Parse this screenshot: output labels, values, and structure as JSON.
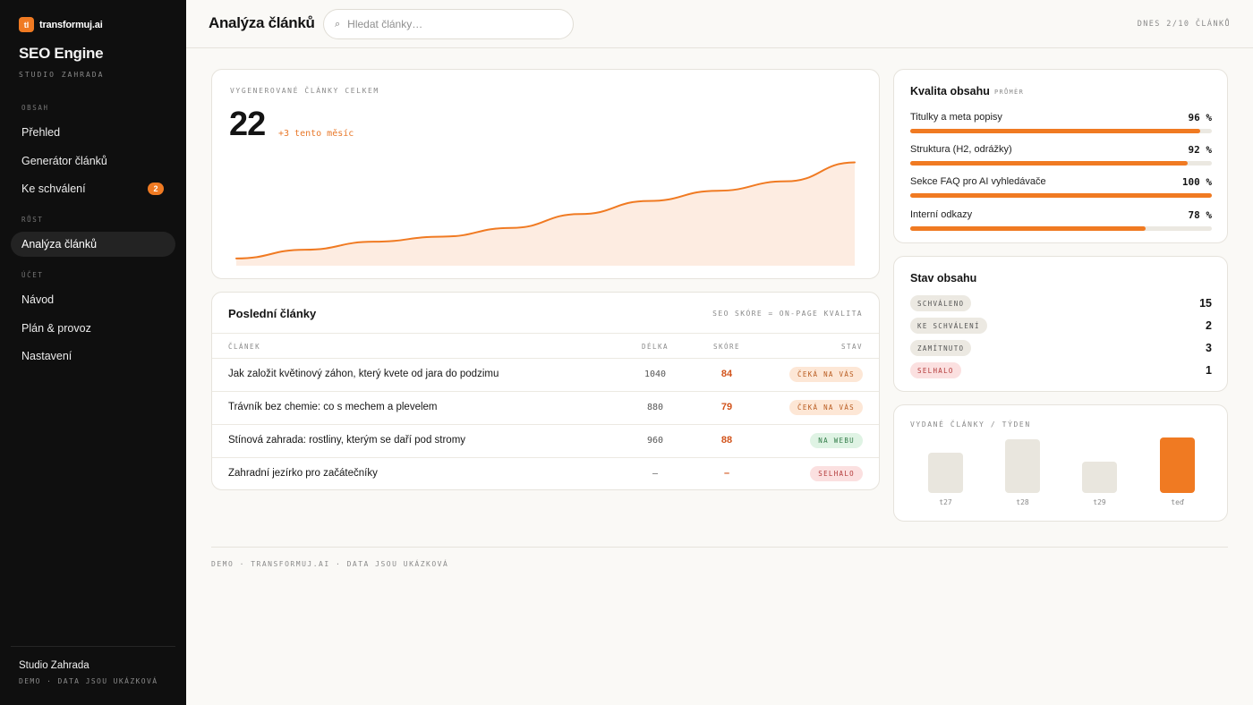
{
  "brand": {
    "logo_mark": "tl",
    "logo_text": "transformuj.ai",
    "app_name": "SEO Engine",
    "workspace": "STUDIO ZAHRADA",
    "accent": "#f07a22"
  },
  "sidebar": {
    "sections": [
      {
        "label": "OBSAH",
        "items": [
          {
            "label": "Přehled"
          },
          {
            "label": "Generátor článků"
          },
          {
            "label": "Ke schválení",
            "badge": "2"
          }
        ]
      },
      {
        "label": "RŮST",
        "items": [
          {
            "label": "Analýza článků",
            "active": true
          }
        ]
      },
      {
        "label": "ÚČET",
        "items": [
          {
            "label": "Návod"
          },
          {
            "label": "Plán & provoz"
          },
          {
            "label": "Nastavení"
          }
        ]
      }
    ],
    "footer_name": "Studio Zahrada",
    "footer_note": "DEMO · DATA JSOU UKÁZKOVÁ"
  },
  "topbar": {
    "title": "Analýza článků",
    "search_placeholder": "Hledat články…",
    "meta": "DNES 2/10 ČLÁNKŮ"
  },
  "total": {
    "kicker": "VYGENEROVANÉ ČLÁNKY CELKEM",
    "value": "22",
    "delta": "+3 tento měsíc",
    "trend": [
      8,
      9.2,
      10.3,
      11,
      12.2,
      14.1,
      15.9,
      17.3,
      18.6,
      21.2
    ]
  },
  "articles": {
    "title": "Poslední články",
    "meta": "SEO SKÓRE = ON-PAGE KVALITA",
    "columns": {
      "article": "ČLÁNEK",
      "length": "DÉLKA",
      "score": "SKÓRE",
      "status": "STAV"
    },
    "rows": [
      {
        "title": "Jak založit květinový záhon, který kvete od jara do podzimu",
        "length": "1040",
        "score": "84",
        "status": "ČEKÁ NA VÁS",
        "status_kind": "pending"
      },
      {
        "title": "Trávník bez chemie: co s mechem a plevelem",
        "length": "880",
        "score": "79",
        "status": "ČEKÁ NA VÁS",
        "status_kind": "pending"
      },
      {
        "title": "Stínová zahrada: rostliny, kterým se daří pod stromy",
        "length": "960",
        "score": "88",
        "status": "NA WEBU",
        "status_kind": "live"
      },
      {
        "title": "Zahradní jezírko pro začátečníky",
        "length": "–",
        "score": "–",
        "status": "SELHALO",
        "status_kind": "failed"
      }
    ]
  },
  "quality": {
    "title": "Kvalita obsahu",
    "subtitle": "PRŮMĚR",
    "metrics": [
      {
        "label": "Titulky a meta popisy",
        "value": "96 %",
        "percent": 96
      },
      {
        "label": "Struktura (H2, odrážky)",
        "value": "92 %",
        "percent": 92
      },
      {
        "label": "Sekce FAQ pro AI vyhledávače",
        "value": "100 %",
        "percent": 100
      },
      {
        "label": "Interní odkazy",
        "value": "78 %",
        "percent": 78
      }
    ]
  },
  "status": {
    "title": "Stav obsahu",
    "rows": [
      {
        "label": "SCHVÁLENO",
        "count": "15",
        "kind": "neutral"
      },
      {
        "label": "KE SCHVÁLENÍ",
        "count": "2",
        "kind": "neutral"
      },
      {
        "label": "ZAMÍTNUTO",
        "count": "3",
        "kind": "neutral"
      },
      {
        "label": "SELHALO",
        "count": "1",
        "kind": "failed"
      }
    ]
  },
  "weekly": {
    "kicker": "VYDANÉ ČLÁNKY / TÝDEN",
    "bars": [
      {
        "label": "t27",
        "value": 0.72,
        "current": false
      },
      {
        "label": "t28",
        "value": 0.96,
        "current": false
      },
      {
        "label": "t29",
        "value": 0.57,
        "current": false
      },
      {
        "label": "teď",
        "value": 1.0,
        "current": true
      }
    ]
  },
  "footer": "DEMO · TRANSFORMUJ.AI · DATA JSOU UKÁZKOVÁ",
  "colors": {
    "accent": "#f07a22",
    "score": "#d2541c",
    "pending_bg": "#fde7d6",
    "pending_fg": "#b85a1e",
    "live_bg": "#dff3e4",
    "live_fg": "#2f7a46",
    "failed_bg": "#fbe0e0",
    "failed_fg": "#b33a3a",
    "neutral_bg": "#ece9e2",
    "neutral_fg": "#555555",
    "bar_neutral": "#e9e6de"
  }
}
